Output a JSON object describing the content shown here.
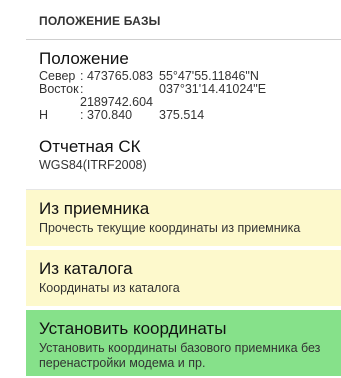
{
  "header": {
    "title": "ПОЛОЖЕНИЕ БАЗЫ"
  },
  "position": {
    "title": "Положение",
    "rows": [
      {
        "label": "Север",
        "value": ": 473765.083",
        "geo": "55°47'55.11846\"N"
      },
      {
        "label": "Восток",
        "value": ": 2189742.604",
        "geo": "037°31'14.41024\"E"
      },
      {
        "label": "H",
        "value": ": 370.840",
        "geo": "375.514"
      }
    ]
  },
  "crs": {
    "title": "Отчетная СК",
    "value": "WGS84(ITRF2008)"
  },
  "from_receiver": {
    "title": "Из приемника",
    "subtitle": "Прочесть текущие координаты из приемника"
  },
  "from_catalog": {
    "title": "Из каталога",
    "subtitle": "Координаты из каталога"
  },
  "set_coords": {
    "title": "Установить координаты",
    "subtitle": "Установить координаты базового приемника без перенастройки модема и пр."
  },
  "colors": {
    "yellow": "#fdf9cc",
    "green": "#86e18a"
  }
}
